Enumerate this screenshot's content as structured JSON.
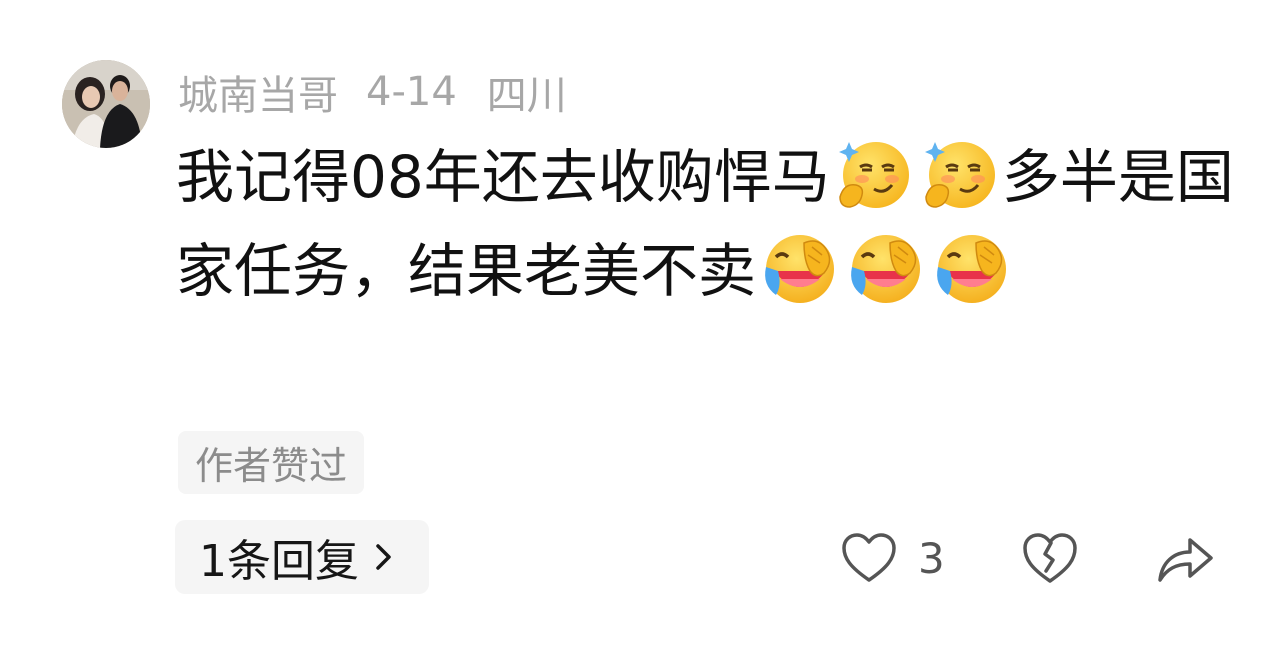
{
  "comment": {
    "username": "城南当哥",
    "date": "4-14",
    "location": "四川",
    "content_parts": [
      {
        "type": "text",
        "value": "我记得08年还去收购悍马"
      },
      {
        "type": "emoji",
        "name": "smug-thinking-emoji"
      },
      {
        "type": "emoji",
        "name": "smug-thinking-emoji"
      },
      {
        "type": "text",
        "value": "多半是国家任务，结果老美不卖"
      },
      {
        "type": "emoji",
        "name": "laughing-crying-emoji"
      },
      {
        "type": "emoji",
        "name": "laughing-crying-emoji"
      },
      {
        "type": "emoji",
        "name": "laughing-crying-emoji"
      }
    ],
    "text_1": "我记得08年还去收购悍马",
    "text_2": "多半是国家任务，结果老美不卖",
    "author_badge": "作者赞过",
    "reply_label": "1条回复",
    "like_count": "3",
    "icons": {
      "like": "heart-icon",
      "dislike": "broken-heart-icon",
      "share": "share-arrow-icon",
      "reply_chevron": "chevron-right-icon"
    },
    "colors": {
      "meta_text": "#a7a7a7",
      "body_text": "#111111",
      "badge_bg": "#f5f5f5",
      "icon_stroke": "#555555"
    }
  }
}
